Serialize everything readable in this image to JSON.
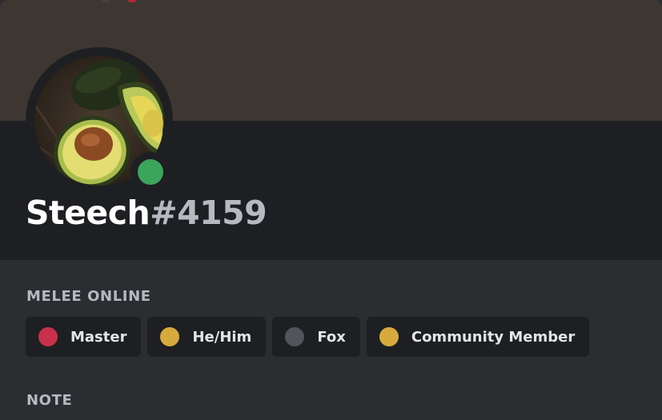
{
  "profile": {
    "name": "Steech",
    "tag": "#4159",
    "status": "online",
    "status_color": "#3ba55c",
    "banner_color": "#3e3630"
  },
  "server": {
    "title": "MELEE ONLINE",
    "roles": [
      {
        "label": "Master",
        "color": "#c9304a"
      },
      {
        "label": "He/Him",
        "color": "#d7aa3e"
      },
      {
        "label": "Fox",
        "color": "#52545b"
      },
      {
        "label": "Community Member",
        "color": "#d7aa3e"
      }
    ]
  },
  "note": {
    "title": "NOTE"
  }
}
